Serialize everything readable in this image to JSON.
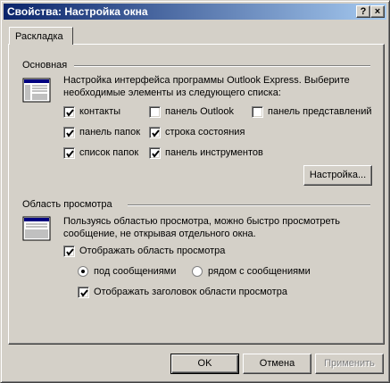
{
  "window": {
    "title": "Свойства: Настройка окна",
    "help_glyph": "?",
    "close_glyph": "×"
  },
  "tab": {
    "label": "Раскладка"
  },
  "basic": {
    "title": "Основная",
    "description": "Настройка интерфейса программы Outlook Express. Выберите необходимые элементы из следующего списка:",
    "checkboxes": [
      {
        "label": "контакты",
        "checked": true
      },
      {
        "label": "панель Outlook",
        "checked": false
      },
      {
        "label": "панель представлений",
        "checked": false
      },
      {
        "label": "панель папок",
        "checked": true
      },
      {
        "label": "строка состояния",
        "checked": true
      },
      {
        "label": "список папок",
        "checked": true
      },
      {
        "label": "панель инструментов",
        "checked": true
      }
    ],
    "customize_button": "Настройка..."
  },
  "preview": {
    "title": "Область просмотра",
    "description": "Пользуясь областью просмотра, можно быстро просмотреть сообщение, не открывая отдельного окна.",
    "show_preview": {
      "label": "Отображать область просмотра",
      "checked": true
    },
    "radios": [
      {
        "label": "под сообщениями",
        "selected": true
      },
      {
        "label": "рядом с сообщениями",
        "selected": false
      }
    ],
    "show_header": {
      "label": "Отображать заголовок области просмотра",
      "checked": true
    }
  },
  "buttons": {
    "ok": "OK",
    "cancel": "Отмена",
    "apply": "Применить"
  }
}
